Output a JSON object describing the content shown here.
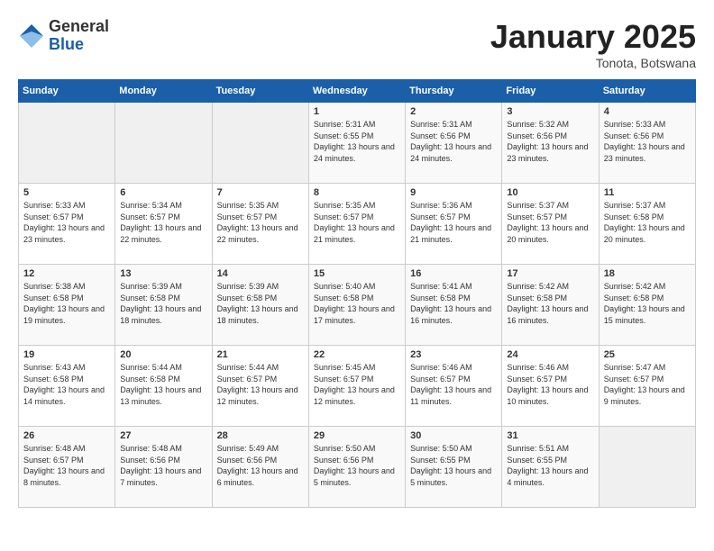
{
  "logo": {
    "general": "General",
    "blue": "Blue"
  },
  "title": "January 2025",
  "location": "Tonota, Botswana",
  "days_of_week": [
    "Sunday",
    "Monday",
    "Tuesday",
    "Wednesday",
    "Thursday",
    "Friday",
    "Saturday"
  ],
  "weeks": [
    [
      {
        "day": "",
        "sunrise": "",
        "sunset": "",
        "daylight": ""
      },
      {
        "day": "",
        "sunrise": "",
        "sunset": "",
        "daylight": ""
      },
      {
        "day": "",
        "sunrise": "",
        "sunset": "",
        "daylight": ""
      },
      {
        "day": "1",
        "sunrise": "Sunrise: 5:31 AM",
        "sunset": "Sunset: 6:55 PM",
        "daylight": "Daylight: 13 hours and 24 minutes."
      },
      {
        "day": "2",
        "sunrise": "Sunrise: 5:31 AM",
        "sunset": "Sunset: 6:56 PM",
        "daylight": "Daylight: 13 hours and 24 minutes."
      },
      {
        "day": "3",
        "sunrise": "Sunrise: 5:32 AM",
        "sunset": "Sunset: 6:56 PM",
        "daylight": "Daylight: 13 hours and 23 minutes."
      },
      {
        "day": "4",
        "sunrise": "Sunrise: 5:33 AM",
        "sunset": "Sunset: 6:56 PM",
        "daylight": "Daylight: 13 hours and 23 minutes."
      }
    ],
    [
      {
        "day": "5",
        "sunrise": "Sunrise: 5:33 AM",
        "sunset": "Sunset: 6:57 PM",
        "daylight": "Daylight: 13 hours and 23 minutes."
      },
      {
        "day": "6",
        "sunrise": "Sunrise: 5:34 AM",
        "sunset": "Sunset: 6:57 PM",
        "daylight": "Daylight: 13 hours and 22 minutes."
      },
      {
        "day": "7",
        "sunrise": "Sunrise: 5:35 AM",
        "sunset": "Sunset: 6:57 PM",
        "daylight": "Daylight: 13 hours and 22 minutes."
      },
      {
        "day": "8",
        "sunrise": "Sunrise: 5:35 AM",
        "sunset": "Sunset: 6:57 PM",
        "daylight": "Daylight: 13 hours and 21 minutes."
      },
      {
        "day": "9",
        "sunrise": "Sunrise: 5:36 AM",
        "sunset": "Sunset: 6:57 PM",
        "daylight": "Daylight: 13 hours and 21 minutes."
      },
      {
        "day": "10",
        "sunrise": "Sunrise: 5:37 AM",
        "sunset": "Sunset: 6:57 PM",
        "daylight": "Daylight: 13 hours and 20 minutes."
      },
      {
        "day": "11",
        "sunrise": "Sunrise: 5:37 AM",
        "sunset": "Sunset: 6:58 PM",
        "daylight": "Daylight: 13 hours and 20 minutes."
      }
    ],
    [
      {
        "day": "12",
        "sunrise": "Sunrise: 5:38 AM",
        "sunset": "Sunset: 6:58 PM",
        "daylight": "Daylight: 13 hours and 19 minutes."
      },
      {
        "day": "13",
        "sunrise": "Sunrise: 5:39 AM",
        "sunset": "Sunset: 6:58 PM",
        "daylight": "Daylight: 13 hours and 18 minutes."
      },
      {
        "day": "14",
        "sunrise": "Sunrise: 5:39 AM",
        "sunset": "Sunset: 6:58 PM",
        "daylight": "Daylight: 13 hours and 18 minutes."
      },
      {
        "day": "15",
        "sunrise": "Sunrise: 5:40 AM",
        "sunset": "Sunset: 6:58 PM",
        "daylight": "Daylight: 13 hours and 17 minutes."
      },
      {
        "day": "16",
        "sunrise": "Sunrise: 5:41 AM",
        "sunset": "Sunset: 6:58 PM",
        "daylight": "Daylight: 13 hours and 16 minutes."
      },
      {
        "day": "17",
        "sunrise": "Sunrise: 5:42 AM",
        "sunset": "Sunset: 6:58 PM",
        "daylight": "Daylight: 13 hours and 16 minutes."
      },
      {
        "day": "18",
        "sunrise": "Sunrise: 5:42 AM",
        "sunset": "Sunset: 6:58 PM",
        "daylight": "Daylight: 13 hours and 15 minutes."
      }
    ],
    [
      {
        "day": "19",
        "sunrise": "Sunrise: 5:43 AM",
        "sunset": "Sunset: 6:58 PM",
        "daylight": "Daylight: 13 hours and 14 minutes."
      },
      {
        "day": "20",
        "sunrise": "Sunrise: 5:44 AM",
        "sunset": "Sunset: 6:58 PM",
        "daylight": "Daylight: 13 hours and 13 minutes."
      },
      {
        "day": "21",
        "sunrise": "Sunrise: 5:44 AM",
        "sunset": "Sunset: 6:57 PM",
        "daylight": "Daylight: 13 hours and 12 minutes."
      },
      {
        "day": "22",
        "sunrise": "Sunrise: 5:45 AM",
        "sunset": "Sunset: 6:57 PM",
        "daylight": "Daylight: 13 hours and 12 minutes."
      },
      {
        "day": "23",
        "sunrise": "Sunrise: 5:46 AM",
        "sunset": "Sunset: 6:57 PM",
        "daylight": "Daylight: 13 hours and 11 minutes."
      },
      {
        "day": "24",
        "sunrise": "Sunrise: 5:46 AM",
        "sunset": "Sunset: 6:57 PM",
        "daylight": "Daylight: 13 hours and 10 minutes."
      },
      {
        "day": "25",
        "sunrise": "Sunrise: 5:47 AM",
        "sunset": "Sunset: 6:57 PM",
        "daylight": "Daylight: 13 hours and 9 minutes."
      }
    ],
    [
      {
        "day": "26",
        "sunrise": "Sunrise: 5:48 AM",
        "sunset": "Sunset: 6:57 PM",
        "daylight": "Daylight: 13 hours and 8 minutes."
      },
      {
        "day": "27",
        "sunrise": "Sunrise: 5:48 AM",
        "sunset": "Sunset: 6:56 PM",
        "daylight": "Daylight: 13 hours and 7 minutes."
      },
      {
        "day": "28",
        "sunrise": "Sunrise: 5:49 AM",
        "sunset": "Sunset: 6:56 PM",
        "daylight": "Daylight: 13 hours and 6 minutes."
      },
      {
        "day": "29",
        "sunrise": "Sunrise: 5:50 AM",
        "sunset": "Sunset: 6:56 PM",
        "daylight": "Daylight: 13 hours and 5 minutes."
      },
      {
        "day": "30",
        "sunrise": "Sunrise: 5:50 AM",
        "sunset": "Sunset: 6:55 PM",
        "daylight": "Daylight: 13 hours and 5 minutes."
      },
      {
        "day": "31",
        "sunrise": "Sunrise: 5:51 AM",
        "sunset": "Sunset: 6:55 PM",
        "daylight": "Daylight: 13 hours and 4 minutes."
      },
      {
        "day": "",
        "sunrise": "",
        "sunset": "",
        "daylight": ""
      }
    ]
  ]
}
